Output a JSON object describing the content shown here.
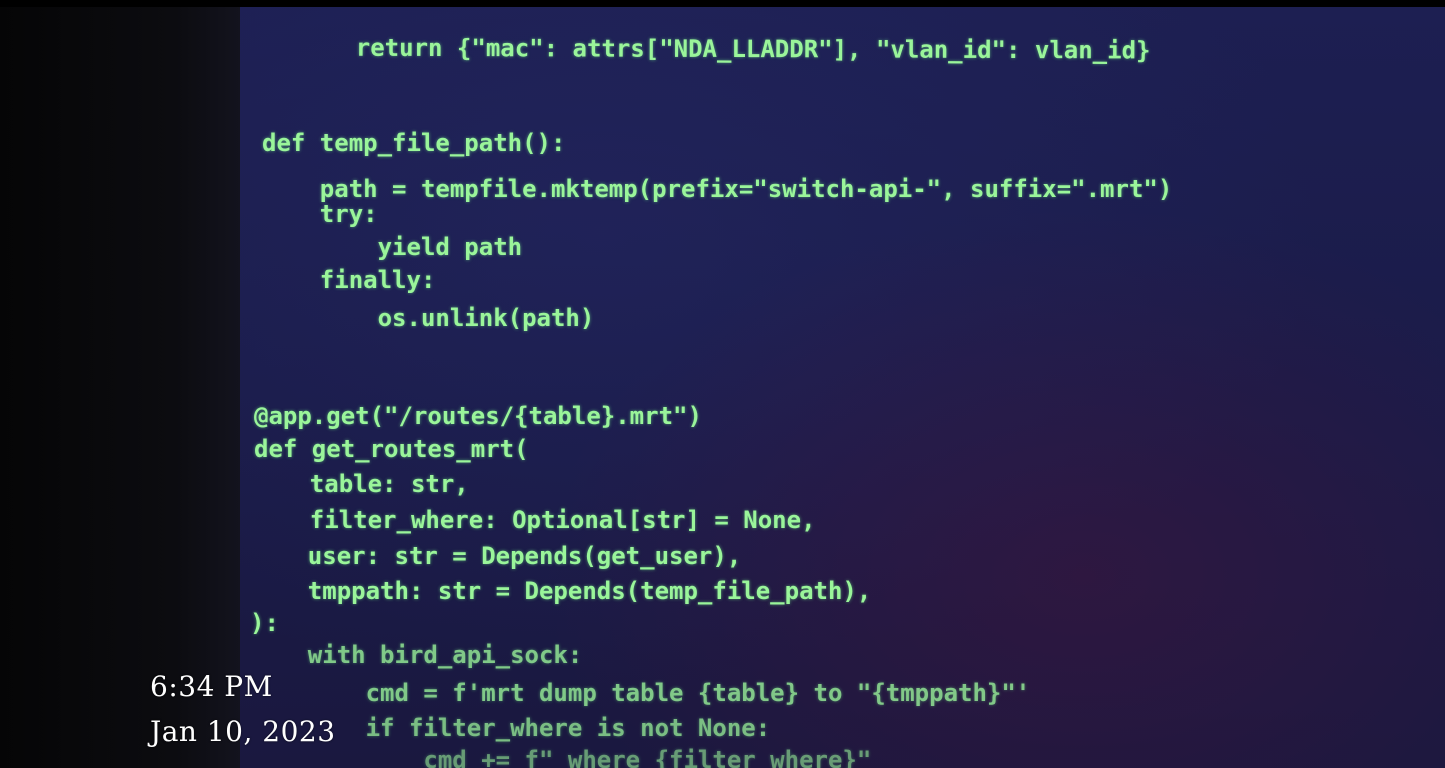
{
  "code_lines": [
    "    return {\"mac\": attrs[\"NDA_LLADDR\"], \"vlan_id\": vlan_id}",
    "def temp_file_path():",
    "    path = tempfile.mktemp(prefix=\"switch-api-\", suffix=\".mrt\")",
    "    try:",
    "        yield path",
    "    finally:",
    "        os.unlink(path)",
    "@app.get(\"/routes/{table}.mrt\")",
    "def get_routes_mrt(",
    "    table: str,",
    "    filter_where: Optional[str] = None,",
    "    user: str = Depends(get_user),",
    "    tmppath: str = Depends(temp_file_path),",
    "):",
    "    with bird_api_sock:",
    "        cmd = f'mrt dump table {table} to \"{tmppath}\"'",
    "        if filter_where is not None:",
    "            cmd += f\" where {filter_where}\""
  ],
  "overlay": {
    "time": "6:34 PM",
    "date": "Jan 10, 2023"
  },
  "colors": {
    "code_text": "#9af59a",
    "screen_bg": "#1d1f52",
    "overlay_text": "#ffffff"
  }
}
